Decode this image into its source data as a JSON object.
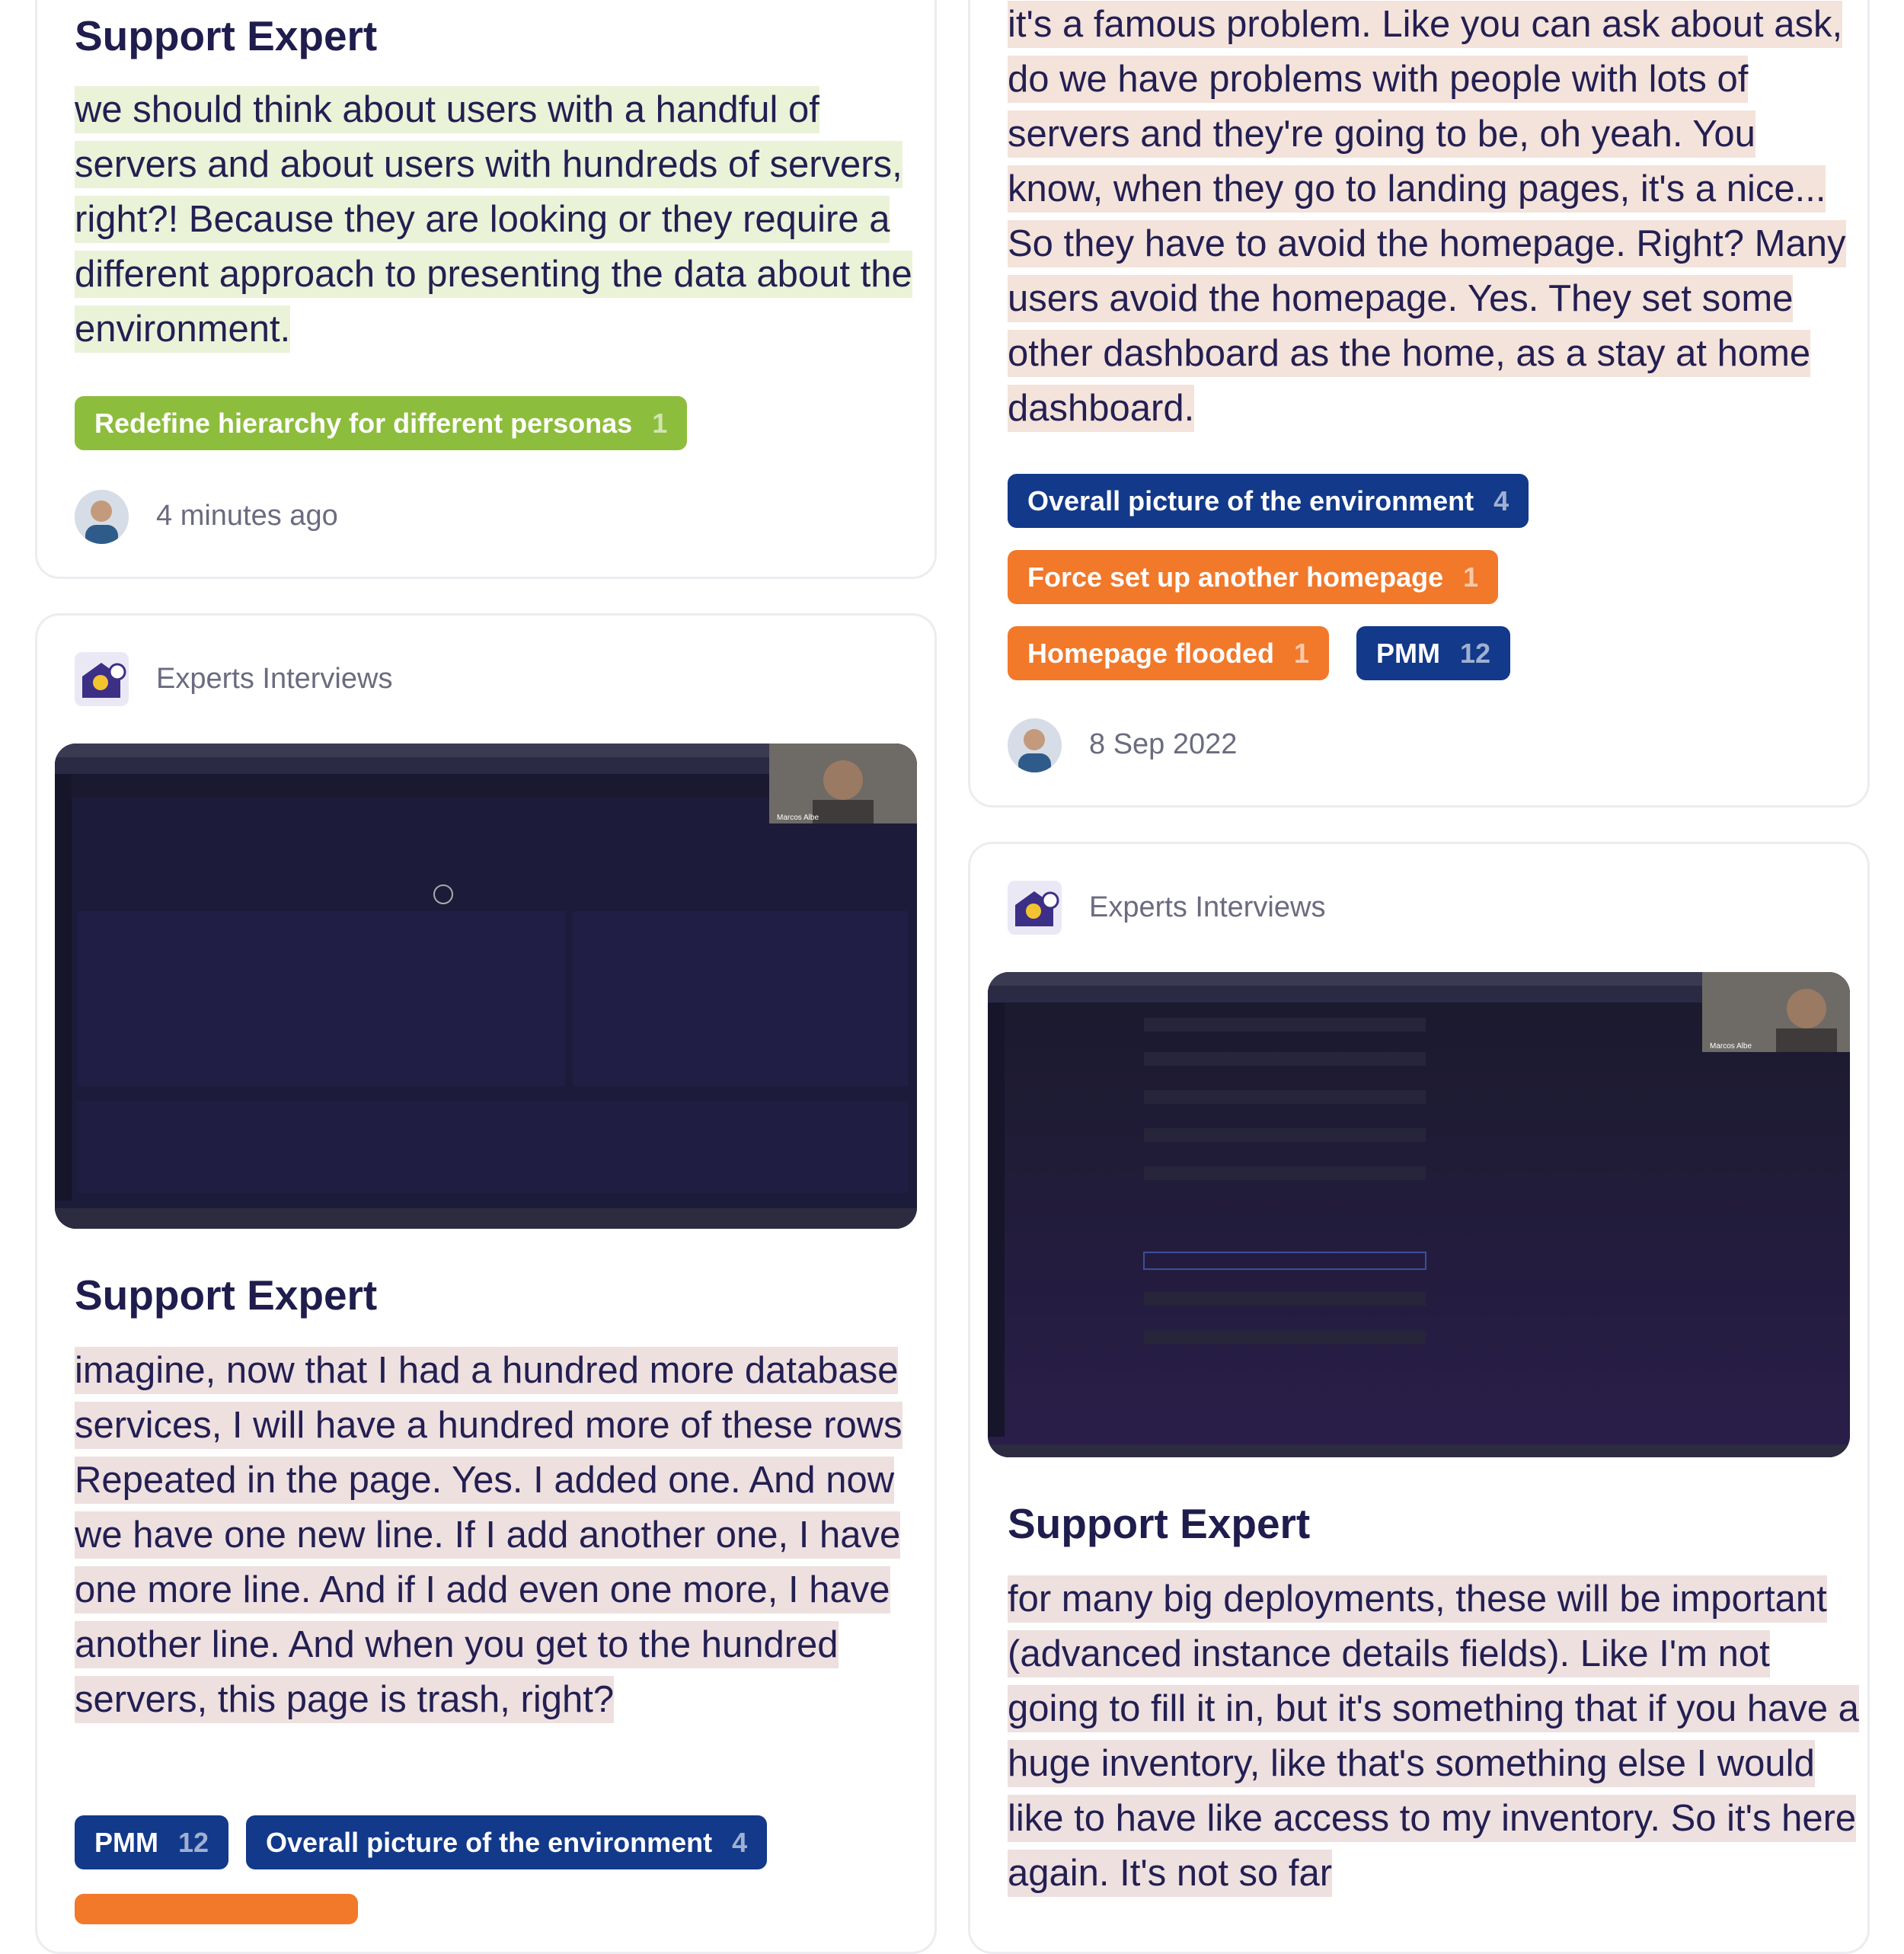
{
  "cards": {
    "left_top": {
      "speaker": "Support Expert",
      "quote": "we should think about users with a handful of servers and about users with hundreds of servers, right?! Because they are looking or they require a different approach to presenting the data about the environment.",
      "tags": [
        {
          "label": "Redefine hierarchy for different personas",
          "count": "1",
          "color": "#8dbd3c"
        }
      ],
      "timestamp": "4 minutes ago"
    },
    "left_bottom": {
      "source": "Experts Interviews",
      "video": {
        "webcam_name": "Marcos Albe"
      },
      "speaker": "Support Expert",
      "quote": "imagine, now that I had a hundred more database services, I will have a hundred more of these rows Repeated in the page. Yes. I added one. And now we have one new line. If I add another one, I have one more line. And if I add even one more, I have another line. And when you get to the hundred servers, this page is trash, right?",
      "tags": [
        {
          "label": "PMM",
          "count": "12",
          "color": "#12398a"
        },
        {
          "label": "Overall picture of the environment",
          "count": "4",
          "color": "#12398a"
        }
      ]
    },
    "right_top": {
      "quote": "it's a famous problem. Like you can ask about ask, do we have problems with people with lots of servers and they're going to be, oh yeah. You know, when they go to landing pages, it's a nice... So they have to avoid the homepage. Right? Many users avoid the homepage. Yes. They set some other dashboard as the home, as a stay at home dashboard.",
      "tags": [
        {
          "label": "Overall picture of the environment",
          "count": "4",
          "color": "#12398a"
        },
        {
          "label": "Force set up another homepage",
          "count": "1",
          "color": "#f2782a"
        },
        {
          "label": "Homepage flooded",
          "count": "1",
          "color": "#f2782a"
        },
        {
          "label": "PMM",
          "count": "12",
          "color": "#12398a"
        }
      ],
      "timestamp": "8 Sep 2022"
    },
    "right_bottom": {
      "source": "Experts Interviews",
      "video": {
        "webcam_name": "Marcos Albe"
      },
      "speaker": "Support Expert",
      "quote": "for many big deployments, these will be important (advanced instance details fields). Like I'm not going to fill it in, but it's something that if you have a huge inventory, like that's something else I would like to have like access to my inventory. So it's here again. It's not so far"
    }
  }
}
